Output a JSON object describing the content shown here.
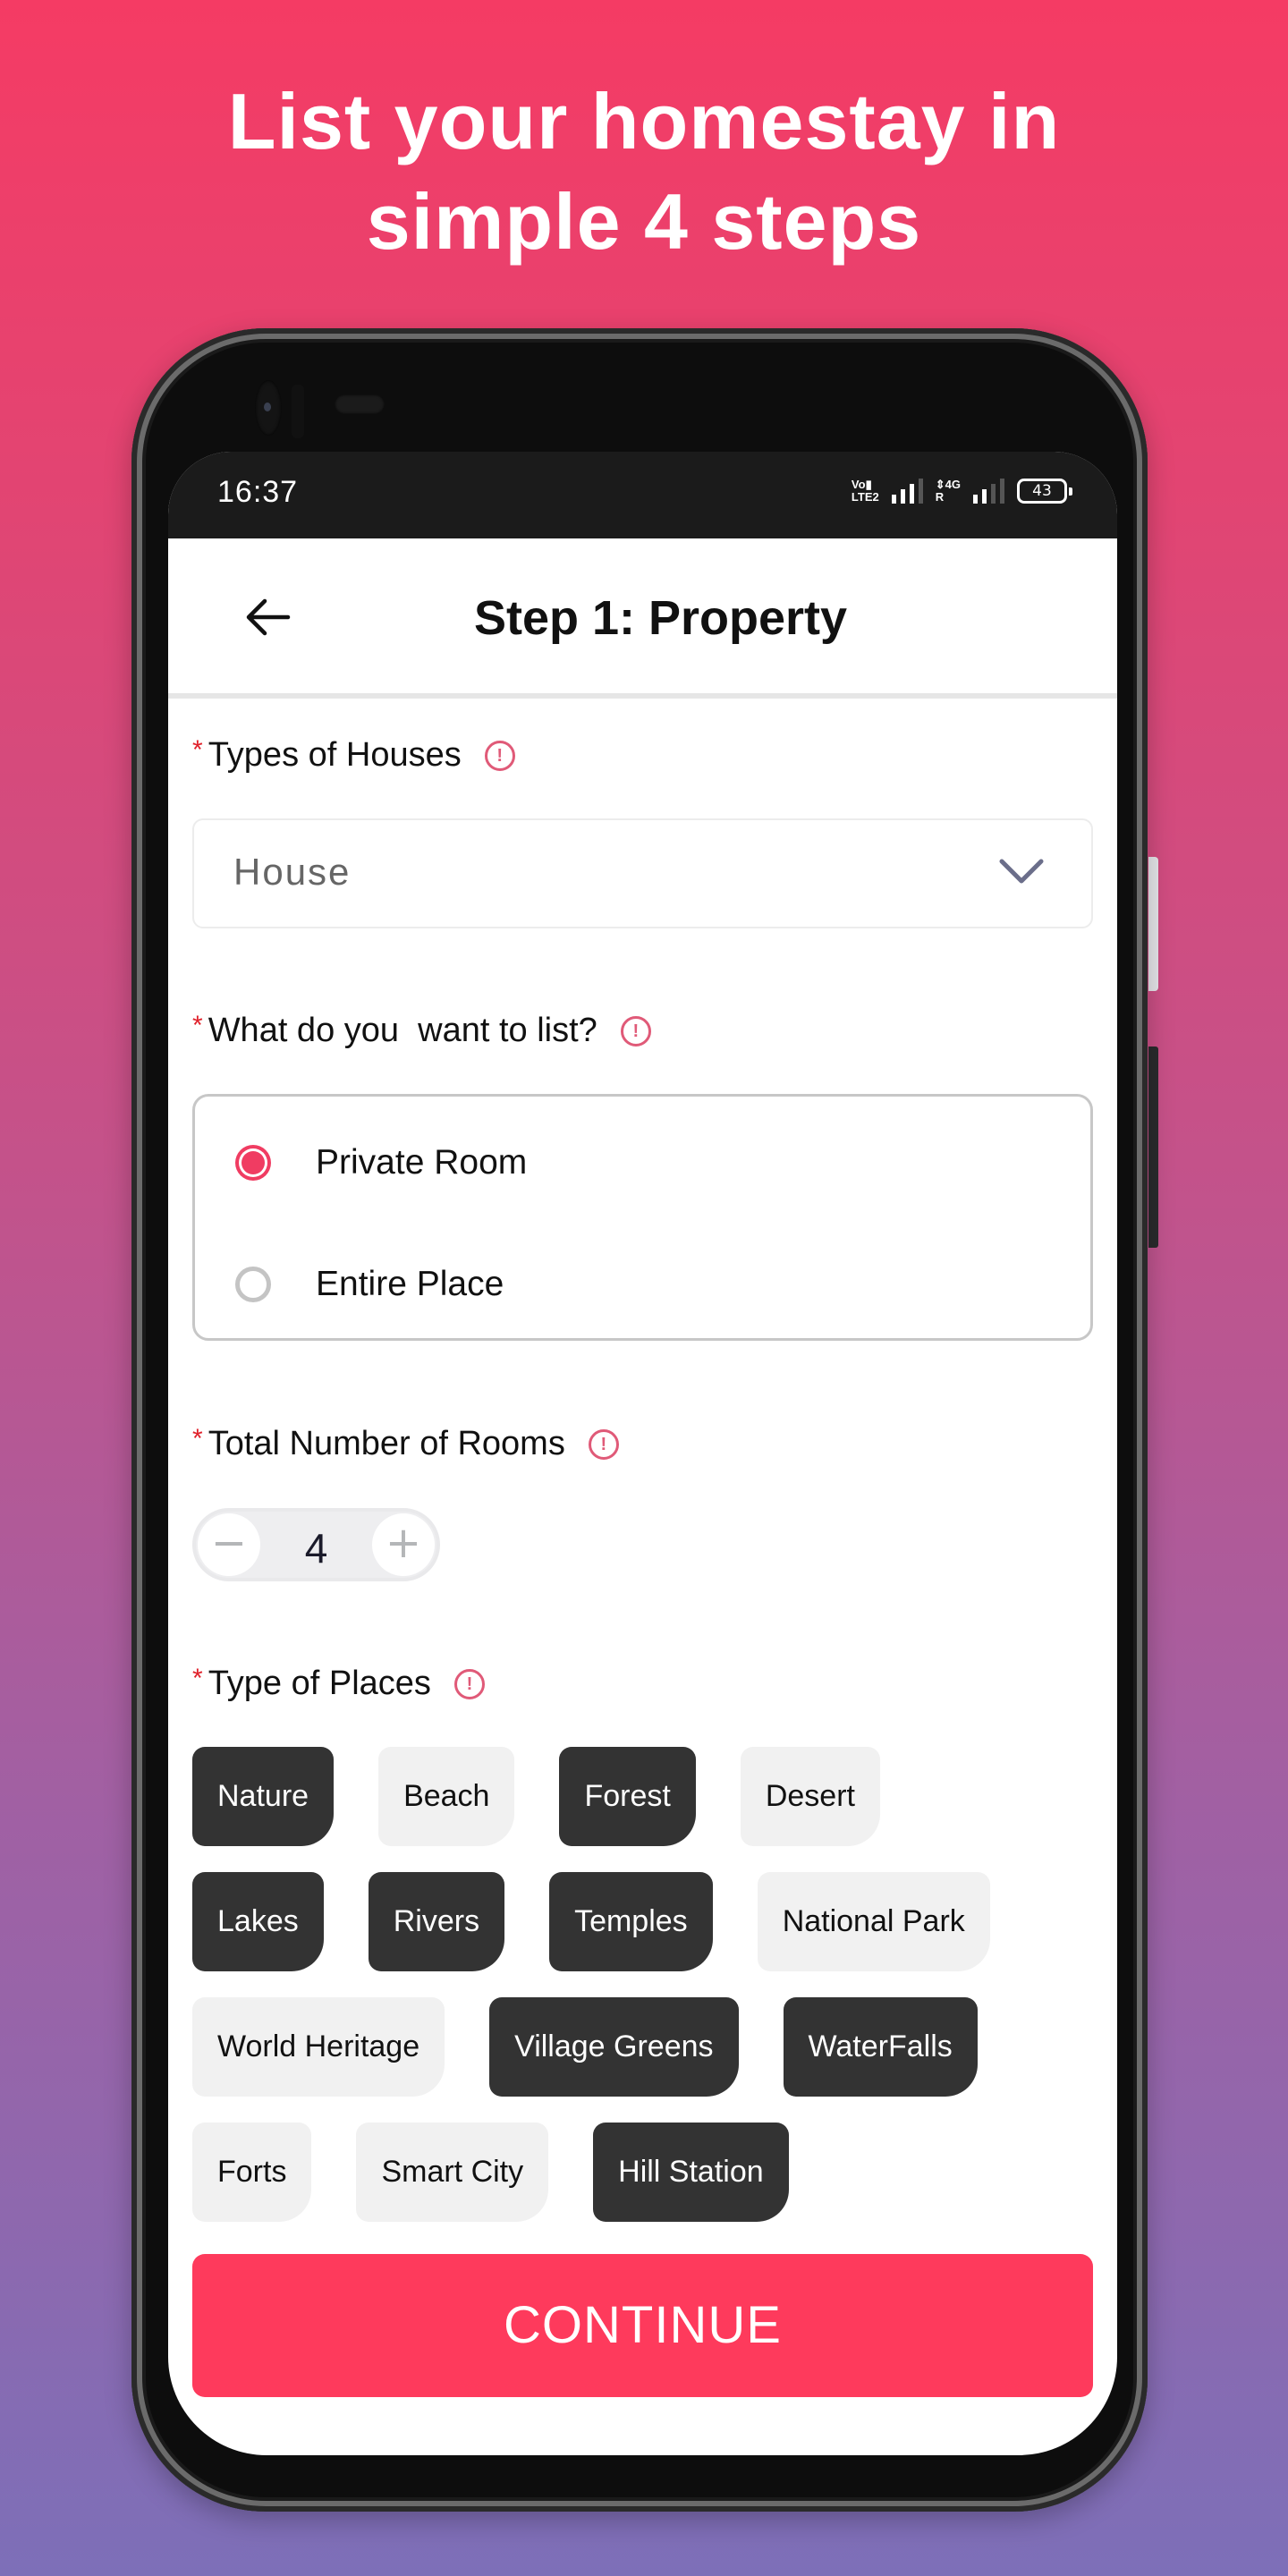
{
  "promo": {
    "title_line1": "List your homestay in",
    "title_line2": "simple 4 steps"
  },
  "status_bar": {
    "time": "16:37",
    "volte_top": "Vo▮",
    "volte_bottom": "LTE2",
    "network": "4G",
    "roaming": "R",
    "battery": "43"
  },
  "header": {
    "back_icon": "arrow-left-icon",
    "title": "Step 1: Property"
  },
  "form": {
    "required_mark": "*",
    "info_glyph": "!",
    "house_type": {
      "label": "Types of Houses",
      "value": "House"
    },
    "listing_type": {
      "label": "What do you  want to list?",
      "options": [
        {
          "label": "Private Room",
          "selected": true
        },
        {
          "label": "Entire Place",
          "selected": false
        }
      ]
    },
    "rooms": {
      "label": "Total Number of Rooms",
      "value": "4",
      "minus": "−",
      "plus": "+"
    },
    "place_types": {
      "label": "Type of Places",
      "rows": [
        [
          {
            "label": "Nature",
            "selected": true
          },
          {
            "label": "Beach",
            "selected": false
          },
          {
            "label": "Forest",
            "selected": true
          },
          {
            "label": "Desert",
            "selected": false
          }
        ],
        [
          {
            "label": "Lakes",
            "selected": true
          },
          {
            "label": "Rivers",
            "selected": true
          },
          {
            "label": "Temples",
            "selected": true
          },
          {
            "label": "National Park",
            "selected": false
          }
        ],
        [
          {
            "label": "World Heritage",
            "selected": false
          },
          {
            "label": "Village Greens",
            "selected": true
          },
          {
            "label": "WaterFalls",
            "selected": true
          }
        ],
        [
          {
            "label": "Forts",
            "selected": false
          },
          {
            "label": "Smart City",
            "selected": false
          },
          {
            "label": "Hill Station",
            "selected": true
          }
        ]
      ]
    }
  },
  "actions": {
    "continue_label": "CONTINUE"
  },
  "colors": {
    "accent": "#fe3a5c",
    "radio_selected": "#f03c62",
    "chip_selected": "#333333",
    "chip_unselected": "#f1f1f1",
    "required": "#e0212b",
    "info": "#e05a78"
  }
}
